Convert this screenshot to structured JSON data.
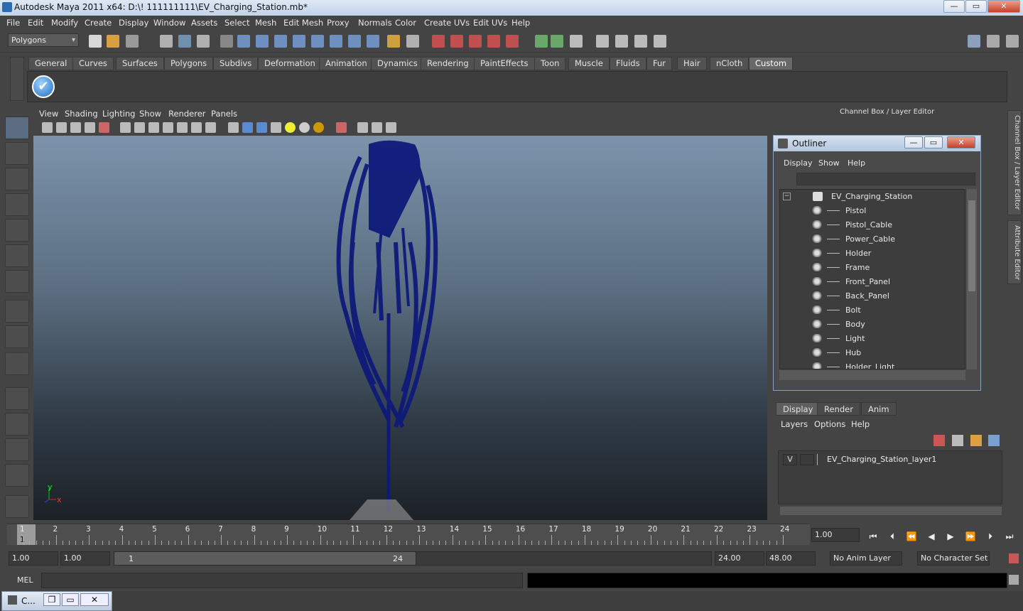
{
  "window": {
    "title": "Autodesk Maya 2011 x64: D:\\! 111111111\\EV_Charging_Station.mb*",
    "btn_min": "—",
    "btn_max": "▭",
    "btn_close": "✕"
  },
  "menu": [
    "File",
    "Edit",
    "Modify",
    "Create",
    "Display",
    "Window",
    "Assets",
    "Select",
    "Mesh",
    "Edit Mesh",
    "Proxy",
    "Normals",
    "Color",
    "Create UVs",
    "Edit UVs",
    "Help"
  ],
  "status": {
    "mode": "Polygons"
  },
  "shelf": {
    "tabs": [
      "General",
      "Curves",
      "Surfaces",
      "Polygons",
      "Subdivs",
      "Deformation",
      "Animation",
      "Dynamics",
      "Rendering",
      "PaintEffects",
      "Toon",
      "Muscle",
      "Fluids",
      "Fur",
      "Hair",
      "nCloth",
      "Custom"
    ],
    "active": "Custom",
    "custom_icon": "✔"
  },
  "panel_menu": [
    "View",
    "Shading",
    "Lighting",
    "Show",
    "Renderer",
    "Panels"
  ],
  "viewport": {
    "axis_y": "y",
    "axis_x": "x"
  },
  "channel_box": {
    "title": "Channel Box / Layer Editor"
  },
  "outliner": {
    "title": "Outliner",
    "menu": [
      "Display",
      "Show",
      "Help"
    ],
    "root": "EV_Charging_Station",
    "items": [
      "Pistol",
      "Pistol_Cable",
      "Power_Cable",
      "Holder",
      "Frame",
      "Front_Panel",
      "Back_Panel",
      "Bolt",
      "Body",
      "Light",
      "Hub",
      "Holder_Light"
    ],
    "btn_min": "—",
    "btn_max": "▭",
    "btn_close": "✕"
  },
  "layer_editor": {
    "tabs": [
      "Display",
      "Render",
      "Anim"
    ],
    "active": "Display",
    "menu": [
      "Layers",
      "Options",
      "Help"
    ],
    "layer": {
      "visibility": "V",
      "name": "EV_Charging_Station_layer1"
    }
  },
  "side_tabs": [
    "Channel Box / Layer Editor",
    "Attribute Editor"
  ],
  "timeline": {
    "ticks": [
      "1",
      "2",
      "3",
      "4",
      "5",
      "6",
      "7",
      "8",
      "9",
      "10",
      "11",
      "12",
      "13",
      "14",
      "15",
      "16",
      "17",
      "18",
      "19",
      "20",
      "21",
      "22",
      "23",
      "24"
    ],
    "current": "1",
    "current_field": "1.00"
  },
  "range": {
    "start": "1.00",
    "start2": "1.00",
    "bar_start": "1",
    "bar_end": "24",
    "end": "24.00",
    "end2": "48.00",
    "anim_layer": "No Anim Layer",
    "char_set": "No Character Set"
  },
  "cmd": {
    "label": "MEL"
  },
  "taskbar": {
    "label": "C..."
  }
}
